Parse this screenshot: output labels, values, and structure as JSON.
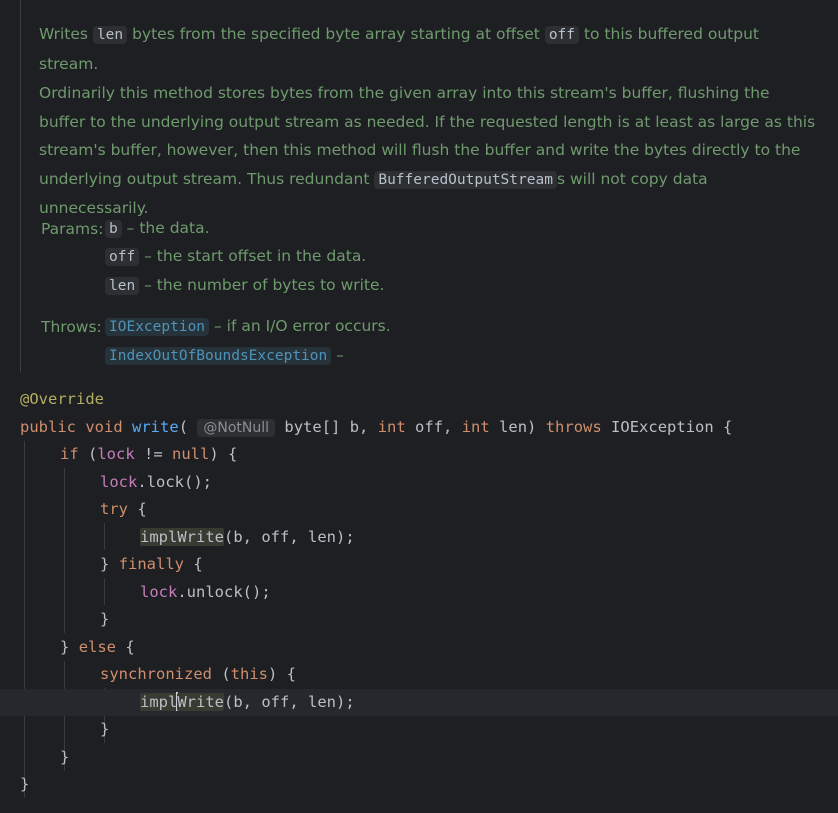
{
  "doc": {
    "summary": [
      "Writes ",
      "len",
      " bytes from the specified byte array starting at offset ",
      "off",
      " to this buffered output stream."
    ],
    "body_1": "Ordinarily this method stores bytes from the given array into this stream's buffer, flushing the buffer to the underlying output stream as needed. If the requested length is at least as large as this stream's buffer, however, then this method will flush the buffer and write the bytes directly to the underlying output stream. Thus redundant ",
    "body_code": "BufferedOutputStream",
    "body_2": "s will not copy data unnecessarily.",
    "params_label": "Params:",
    "params": [
      {
        "name": "b",
        "desc": " – the data."
      },
      {
        "name": "off",
        "desc": " – the start offset in the data."
      },
      {
        "name": "len",
        "desc": " – the number of bytes to write."
      }
    ],
    "throws_label": "Throws:",
    "throws": [
      {
        "name": "IOException",
        "desc": " – if an I/O error occurs."
      },
      {
        "name": "IndexOutOfBoundsException",
        "desc": " –"
      }
    ]
  },
  "code": {
    "annotation": "@Override",
    "sig": {
      "public": "public",
      "void": "void",
      "name": "write",
      "open": "(",
      "inlay": "@NotNull",
      "p1": "byte[] b, ",
      "int1": "int",
      "p2": " off, ",
      "int2": "int",
      "p3": " len) ",
      "throws": "throws",
      "rest": " IOException {"
    },
    "if_kw": "if",
    "if_open": " (",
    "lock": "lock",
    "if_mid": " != ",
    "null_kw": "null",
    "if_close": ") {",
    "lock_call": ".lock();",
    "try_kw": "try",
    "brace_open": " {",
    "impl": "implWrite",
    "impl_args": "(b, off, len);",
    "close_brace": "}",
    "finally_kw": "finally",
    "unlock_call": ".unlock();",
    "else_kw": "else",
    "sync_kw": "synchronized",
    "sync_open": " (",
    "this_kw": "this",
    "sync_close": ") {",
    "impl_a": "impl",
    "impl_b": "Write"
  }
}
